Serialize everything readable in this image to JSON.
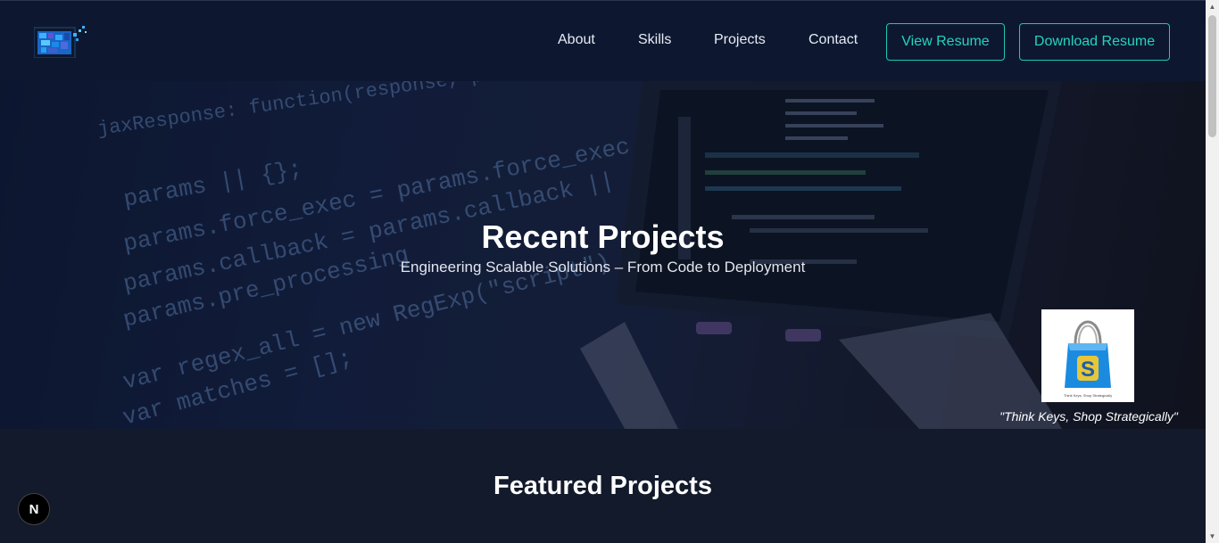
{
  "nav": {
    "items": [
      {
        "label": "About"
      },
      {
        "label": "Skills"
      },
      {
        "label": "Projects"
      },
      {
        "label": "Contact"
      }
    ],
    "view_resume": "View Resume",
    "download_resume": "Download Resume"
  },
  "hero": {
    "title": "Recent Projects",
    "subtitle": "Engineering Scalable Solutions – From Code to Deployment",
    "code_lines": [
      "jaxResponse: function(response, params",
      "params || {};",
      "params.force_exec = params.force_exec",
      "params.callback = params.callback ||",
      "params.pre_processing",
      "var regex_all = new RegExp(\"script\")",
      "var matches = [];"
    ],
    "product_letter": "S",
    "product_caption": "Think Keys, Shop Strategically",
    "tagline": "\"Think Keys, Shop Strategically\""
  },
  "featured": {
    "title": "Featured Projects"
  },
  "dev_badge": "N",
  "colors": {
    "header_bg": "#0d1830",
    "page_bg": "#121a2b",
    "accent": "#26d3c0"
  },
  "icons": {
    "logo": "pixel-logo-icon",
    "scroll_up": "scroll-up-arrow-icon",
    "scroll_down": "scroll-down-arrow-icon"
  }
}
